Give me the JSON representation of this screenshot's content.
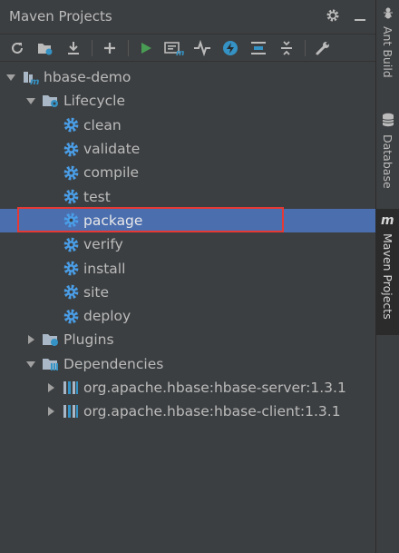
{
  "panel": {
    "title": "Maven Projects"
  },
  "colors": {
    "background": "#3c3f41",
    "selection": "#4b6eaf",
    "gear": "#4a9ee8",
    "run": "#499c54",
    "highlight": "#e53935"
  },
  "toolbar": {
    "icons": [
      "refresh-icon",
      "generate-sources-icon",
      "download-icon",
      "add-icon",
      "run-icon",
      "execute-goal-icon",
      "toggle-offline-icon",
      "skip-tests-icon",
      "show-dependencies-icon",
      "collapse-all-icon",
      "settings-wrench-icon"
    ]
  },
  "tree": {
    "project": "hbase-demo",
    "lifecycle": {
      "label": "Lifecycle",
      "phases": [
        "clean",
        "validate",
        "compile",
        "test",
        "package",
        "verify",
        "install",
        "site",
        "deploy"
      ],
      "selected": "package"
    },
    "plugins": "Plugins",
    "dependencies": {
      "label": "Dependencies",
      "items": [
        "org.apache.hbase:hbase-server:1.3.1",
        "org.apache.hbase:hbase-client:1.3.1"
      ]
    }
  },
  "sidebar": {
    "tabs": [
      {
        "icon": "ant-icon",
        "label": "Ant Build"
      },
      {
        "icon": "database-icon",
        "label": "Database"
      },
      {
        "icon": "maven-icon",
        "label": "Maven Projects"
      }
    ]
  }
}
